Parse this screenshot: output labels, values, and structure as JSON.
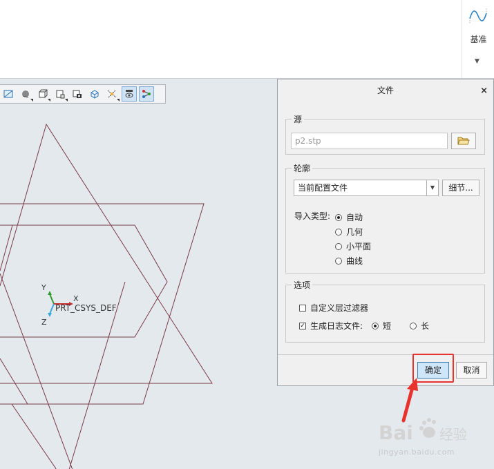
{
  "ribbon": {
    "datum_label": "基准",
    "datum_icon": "datum-curve-icon"
  },
  "toolbar": {
    "icons": [
      "refit-icon",
      "shading-icon",
      "display-style-icon",
      "view-manager-icon",
      "saved-views-icon",
      "orient-icon",
      "datum-display-icon",
      "spin-center-icon",
      "annotation-display-icon"
    ]
  },
  "viewport": {
    "csys_name": "PRT_CSYS_DEF",
    "axis_x": "X",
    "axis_y": "Y",
    "axis_z": "Z"
  },
  "dialog": {
    "title": "文件",
    "close_label": "×",
    "source": {
      "group_title": "源",
      "file_value": "p2.stp",
      "browse_icon": "folder-open-icon"
    },
    "profile": {
      "group_title": "轮廓",
      "selected_profile": "当前配置文件",
      "details_label": "细节...",
      "import_type_label": "导入类型:",
      "options": [
        {
          "label": "自动",
          "checked": true
        },
        {
          "label": "几何",
          "checked": false
        },
        {
          "label": "小平面",
          "checked": false
        },
        {
          "label": "曲线",
          "checked": false
        }
      ]
    },
    "options": {
      "group_title": "选项",
      "custom_layer_filter": "自定义层过滤器",
      "custom_layer_filter_checked": false,
      "generate_log": "生成日志文件:",
      "generate_log_checked": true,
      "log_short": "短",
      "log_long": "长"
    },
    "ok_label": "确定",
    "cancel_label": "取消"
  },
  "watermark": {
    "brand": "Bai du 经验",
    "url": "jingyan.baidu.com"
  },
  "colors": {
    "highlight": "#e8322e",
    "geometry": "#7a3a44",
    "ok_button": "#cfe6f8"
  }
}
